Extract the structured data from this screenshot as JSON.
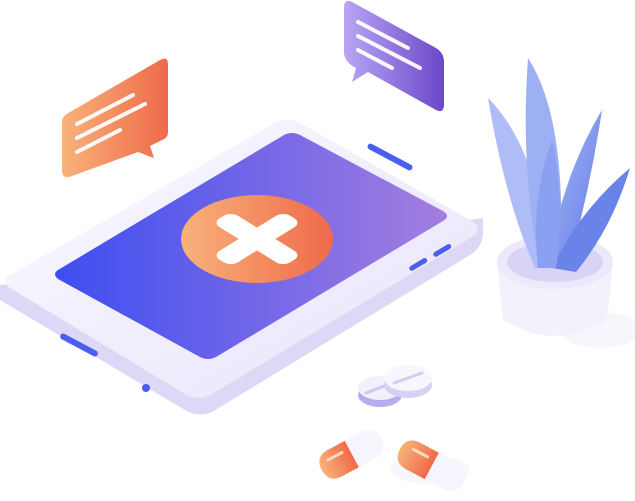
{
  "illustration": {
    "subject": "isometric-smartphone-medical-app",
    "elements": [
      "smartphone",
      "medical-cross-icon",
      "chat-bubble-orange",
      "chat-bubble-purple",
      "potted-plant",
      "pill-tablets",
      "capsule-pills"
    ]
  },
  "colors": {
    "screen_gradient_start": "#3d4ef0",
    "screen_gradient_end": "#a47ee0",
    "orange_start": "#f8b27a",
    "orange_end": "#ef6a4a",
    "purple_start": "#b9a6f4",
    "purple_end": "#6b47c9",
    "plant_light": "#aabaf5",
    "plant_dark": "#5f79e6",
    "phone_body": "#f1effb",
    "phone_side": "#ddd8f5",
    "speaker_blue": "#4a5ef0",
    "cross_white": "#ffffff"
  }
}
